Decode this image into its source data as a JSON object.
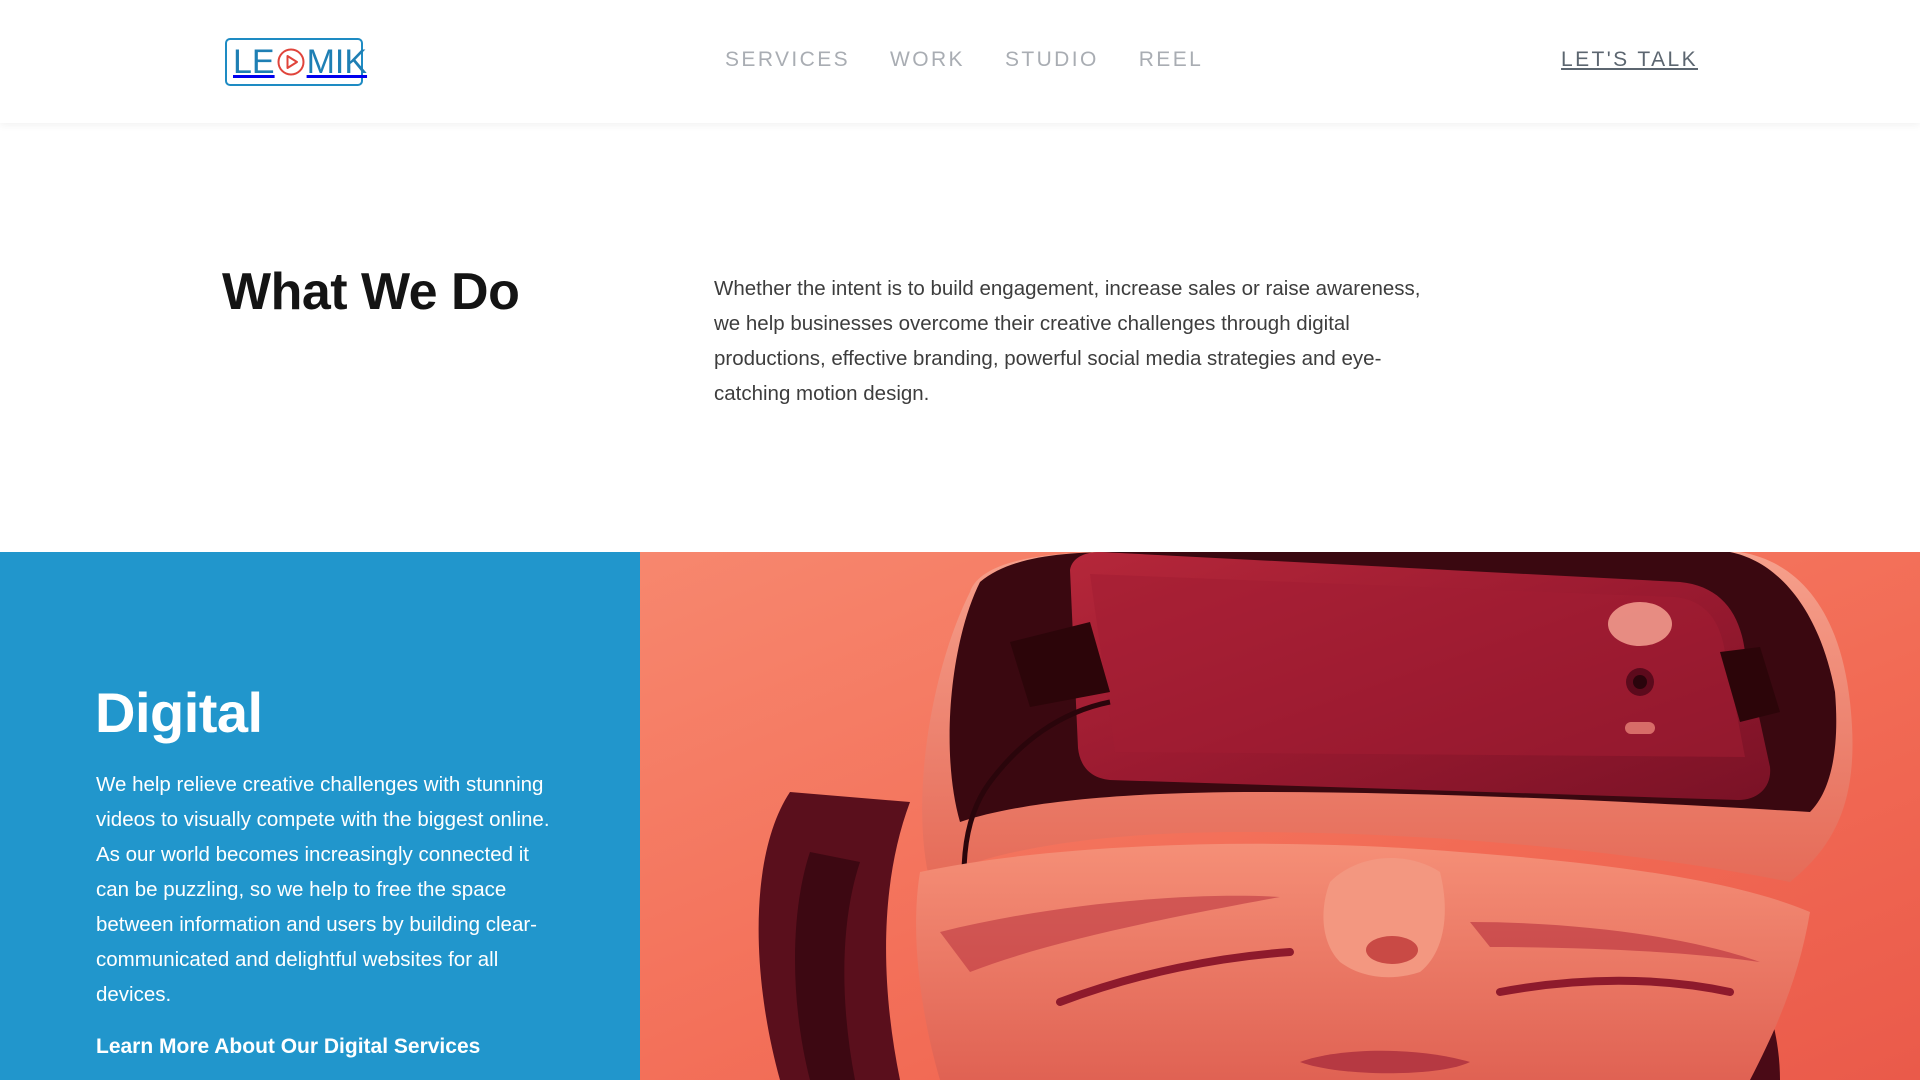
{
  "header": {
    "logo_text_left": "LE",
    "logo_text_right": "MIK",
    "logo_label": "LEOMIK",
    "nav": [
      {
        "label": "SERVICES"
      },
      {
        "label": "WORK"
      },
      {
        "label": "STUDIO"
      },
      {
        "label": "REEL"
      }
    ],
    "cta_label": "LET'S TALK"
  },
  "what_we_do": {
    "heading": "What We Do",
    "body": "Whether the intent is to build engagement, increase sales or raise awareness, we help businesses overcome their creative challenges through digital productions, effective branding, powerful social media strategies and eye-catching motion design."
  },
  "digital": {
    "title": "Digital",
    "body": "We help relieve creative challenges with stunning videos to visually compete with the biggest online. As our world becomes increasingly connected it can be puzzling, so we help to free the space between information and users by building clear-communicated and delightful websites for all devices.",
    "link_label": "Learn More About Our Digital Services"
  },
  "hero_image": {
    "subject": "person-wearing-vr-headset",
    "tint": "#f0604f"
  },
  "colors": {
    "brand_blue": "#2196cc",
    "logo_red": "#e0443b",
    "nav_grey": "#a9adb3",
    "cta_grey": "#5c6670"
  }
}
